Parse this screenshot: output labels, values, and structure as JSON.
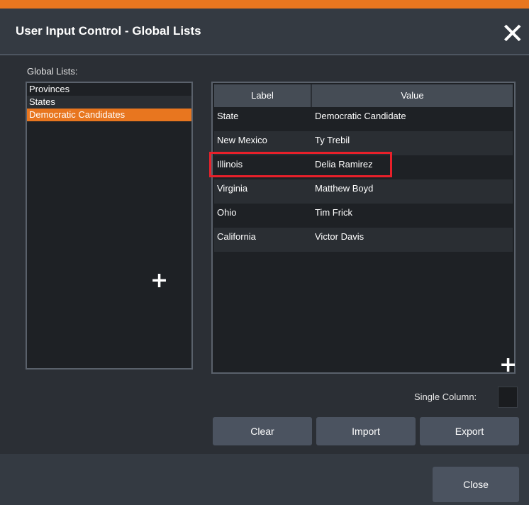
{
  "dialog": {
    "title": "User Input Control - Global Lists",
    "close_icon": "close-x-icon",
    "accent_color": "#e8761f",
    "highlight_color": "#e8202a"
  },
  "global_lists": {
    "label": "Global Lists:",
    "items": [
      "Provinces",
      "States",
      "Democratic Candidates"
    ],
    "selected": "Democratic Candidates",
    "add_icon": "plus-icon"
  },
  "table": {
    "columns": [
      "Label",
      "Value"
    ],
    "rows": [
      {
        "label": "State",
        "value": "Democratic Candidate"
      },
      {
        "label": "New Mexico",
        "value": "Ty Trebil"
      },
      {
        "label": "Illinois",
        "value": "Delia Ramirez"
      },
      {
        "label": "Virginia",
        "value": "Matthew Boyd"
      },
      {
        "label": "Ohio",
        "value": "Tim Frick"
      },
      {
        "label": "California",
        "value": "Victor Davis"
      }
    ],
    "highlighted_row": "Illinois",
    "add_icon": "plus-icon"
  },
  "options": {
    "single_column_label": "Single Column:",
    "single_column_checked": false
  },
  "buttons": {
    "clear": "Clear",
    "import": "Import",
    "export": "Export",
    "close": "Close"
  }
}
